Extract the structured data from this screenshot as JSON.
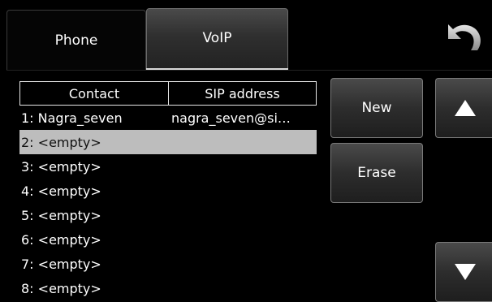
{
  "tabs": [
    {
      "label": "Phone",
      "active": false
    },
    {
      "label": "VoIP",
      "active": true
    }
  ],
  "back_icon": "undo-arrow-icon",
  "table": {
    "headers": [
      "Contact",
      "SIP address"
    ],
    "rows": [
      {
        "contact": "1: Nagra_seven",
        "sip": "nagra_seven@si…"
      },
      {
        "contact": "2: <empty>",
        "sip": ""
      },
      {
        "contact": "3: <empty>",
        "sip": ""
      },
      {
        "contact": "4: <empty>",
        "sip": ""
      },
      {
        "contact": "5: <empty>",
        "sip": ""
      },
      {
        "contact": "6: <empty>",
        "sip": ""
      },
      {
        "contact": "7: <empty>",
        "sip": ""
      },
      {
        "contact": "8: <empty>",
        "sip": ""
      }
    ],
    "selected_row": 2
  },
  "buttons": {
    "new_label": "New",
    "erase_label": "Erase",
    "scroll_up_icon": "triangle-up-icon",
    "scroll_down_icon": "triangle-down-icon"
  },
  "colors": {
    "background": "#000000",
    "selected_row": "#bdbdbd"
  }
}
